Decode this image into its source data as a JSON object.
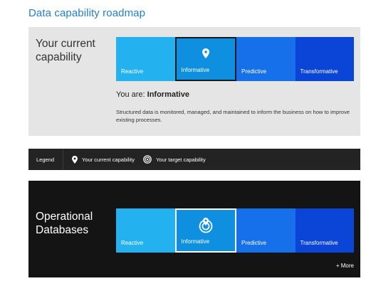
{
  "page": {
    "title": "Data capability roadmap"
  },
  "current": {
    "heading": "Your current capability",
    "scale": [
      {
        "label": "Reactive"
      },
      {
        "label": "Informative"
      },
      {
        "label": "Predictive"
      },
      {
        "label": "Transformative"
      }
    ],
    "selected_index": 1,
    "you_are_prefix": "You are:",
    "you_are_value": "Informative",
    "description": "Structured data is monitored, managed, and maintained to inform the business on how to improve existing processes."
  },
  "legend": {
    "label": "Legend",
    "current_icon": "map-pin-icon",
    "current_label": "Your current capability",
    "target_icon": "target-icon",
    "target_label": "Your target capability"
  },
  "operational": {
    "heading": "Operational Databases",
    "scale": [
      {
        "label": "Reactive"
      },
      {
        "label": "Informative"
      },
      {
        "label": "Predictive"
      },
      {
        "label": "Transformative"
      }
    ],
    "selected_index": 1,
    "more_label": "+ More"
  },
  "colors": {
    "title_blue": "#1f7fd1",
    "reactive": "#23b2ef",
    "informative": "#0e8fe0",
    "predictive": "#1670ea",
    "transformative": "#0a45d8",
    "panel_gray": "#e5e5e5",
    "legend_bg": "#232323",
    "dark_panel": "#141414"
  }
}
